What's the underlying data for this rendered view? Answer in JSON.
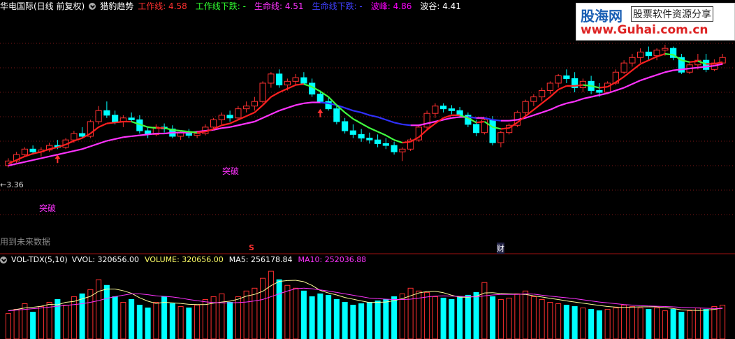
{
  "header": {
    "title": "华电国际(日线 前复权)",
    "indicator_name": "猎豹趋势",
    "items": [
      {
        "label": "工作线: 4.58",
        "color": "#ff3030"
      },
      {
        "label": "工作线下跌: -",
        "color": "#30ff30"
      },
      {
        "label": "生命线: 4.51",
        "color": "#ff33ff"
      },
      {
        "label": "生命线下跌: -",
        "color": "#4040ff"
      },
      {
        "label": "波峰: 4.86",
        "color": "#ff00ff"
      },
      {
        "label": "波谷: 4.41",
        "color": "#ffffff"
      }
    ]
  },
  "logo": {
    "line1": "股海网",
    "tag": "股票软件资源分享",
    "line2": "www.Guhai.com.cn"
  },
  "annotations": {
    "price_low": "←3.36",
    "breakout1": "突破",
    "breakout2": "突破",
    "footer_text": "用到未来数据",
    "marker_s": "S",
    "marker_cai": "财"
  },
  "volume_header": {
    "name": "VOL-TDX(5,10)",
    "items": [
      {
        "label": "VVOL: 320656.00",
        "color": "#ffffff"
      },
      {
        "label": "VOLUME: 320656.00",
        "color": "#ffff66"
      },
      {
        "label": "MA5: 256178.84",
        "color": "#ffffff"
      },
      {
        "label": "MA10: 252036.88",
        "color": "#ff33ff"
      }
    ]
  },
  "colors": {
    "up": "#ff3030",
    "down": "#00ffff",
    "work": "#ff2020",
    "work_down": "#40ff40",
    "life": "#ff33ff",
    "life_down": "#3030ff",
    "grid": "#801818"
  },
  "chart_data": [
    {
      "type": "candlestick",
      "title": "猎豹趋势",
      "ylim": [
        3.3,
        4.75
      ],
      "ohlc": [
        [
          3.4,
          3.48,
          3.38,
          3.45
        ],
        [
          3.45,
          3.55,
          3.43,
          3.52
        ],
        [
          3.52,
          3.6,
          3.5,
          3.58
        ],
        [
          3.58,
          3.62,
          3.52,
          3.55
        ],
        [
          3.55,
          3.6,
          3.5,
          3.57
        ],
        [
          3.57,
          3.65,
          3.55,
          3.62
        ],
        [
          3.62,
          3.68,
          3.58,
          3.6
        ],
        [
          3.6,
          3.7,
          3.58,
          3.68
        ],
        [
          3.68,
          3.78,
          3.65,
          3.75
        ],
        [
          3.75,
          3.82,
          3.7,
          3.72
        ],
        [
          3.72,
          3.9,
          3.7,
          3.88
        ],
        [
          3.88,
          4.05,
          3.85,
          4.0
        ],
        [
          4.0,
          4.1,
          3.92,
          3.95
        ],
        [
          3.95,
          4.0,
          3.85,
          3.88
        ],
        [
          3.88,
          3.95,
          3.82,
          3.92
        ],
        [
          3.92,
          3.98,
          3.88,
          3.9
        ],
        [
          3.9,
          3.95,
          3.75,
          3.78
        ],
        [
          3.78,
          3.82,
          3.7,
          3.74
        ],
        [
          3.74,
          3.85,
          3.72,
          3.82
        ],
        [
          3.82,
          3.86,
          3.76,
          3.8
        ],
        [
          3.8,
          3.84,
          3.7,
          3.72
        ],
        [
          3.72,
          3.78,
          3.68,
          3.76
        ],
        [
          3.76,
          3.8,
          3.7,
          3.73
        ],
        [
          3.73,
          3.78,
          3.7,
          3.75
        ],
        [
          3.75,
          3.85,
          3.73,
          3.82
        ],
        [
          3.82,
          3.92,
          3.8,
          3.9
        ],
        [
          3.9,
          3.98,
          3.85,
          3.95
        ],
        [
          3.95,
          4.0,
          3.88,
          3.92
        ],
        [
          3.92,
          4.05,
          3.9,
          4.02
        ],
        [
          4.02,
          4.1,
          3.98,
          4.05
        ],
        [
          4.05,
          4.15,
          4.0,
          4.1
        ],
        [
          4.1,
          4.32,
          4.08,
          4.3
        ],
        [
          4.3,
          4.42,
          4.25,
          4.4
        ],
        [
          4.4,
          4.45,
          4.25,
          4.28
        ],
        [
          4.28,
          4.35,
          4.22,
          4.32
        ],
        [
          4.32,
          4.4,
          4.28,
          4.36
        ],
        [
          4.36,
          4.42,
          4.28,
          4.3
        ],
        [
          4.3,
          4.35,
          4.15,
          4.18
        ],
        [
          4.18,
          4.22,
          4.08,
          4.1
        ],
        [
          4.1,
          4.15,
          4.0,
          4.02
        ],
        [
          4.02,
          4.05,
          3.85,
          3.88
        ],
        [
          3.88,
          3.92,
          3.75,
          3.78
        ],
        [
          3.78,
          3.85,
          3.7,
          3.74
        ],
        [
          3.74,
          3.8,
          3.66,
          3.7
        ],
        [
          3.7,
          3.76,
          3.64,
          3.68
        ],
        [
          3.68,
          3.74,
          3.6,
          3.64
        ],
        [
          3.64,
          3.7,
          3.58,
          3.62
        ],
        [
          3.62,
          3.66,
          3.52,
          3.55
        ],
        [
          3.55,
          3.6,
          3.45,
          3.58
        ],
        [
          3.58,
          3.7,
          3.56,
          3.68
        ],
        [
          3.68,
          3.85,
          3.66,
          3.82
        ],
        [
          3.82,
          4.0,
          3.8,
          3.97
        ],
        [
          3.97,
          4.08,
          3.92,
          4.05
        ],
        [
          4.05,
          4.08,
          3.98,
          4.02
        ],
        [
          4.02,
          4.06,
          3.96,
          4.0
        ],
        [
          4.0,
          4.04,
          3.92,
          3.95
        ],
        [
          3.95,
          3.98,
          3.82,
          3.85
        ],
        [
          3.85,
          3.9,
          3.72,
          3.76
        ],
        [
          3.76,
          3.92,
          3.74,
          3.9
        ],
        [
          3.9,
          3.94,
          3.62,
          3.65
        ],
        [
          3.65,
          3.78,
          3.6,
          3.76
        ],
        [
          3.76,
          3.86,
          3.74,
          3.84
        ],
        [
          3.84,
          4.0,
          3.82,
          3.98
        ],
        [
          3.98,
          4.12,
          3.95,
          4.1
        ],
        [
          4.1,
          4.18,
          4.05,
          4.15
        ],
        [
          4.15,
          4.25,
          4.1,
          4.22
        ],
        [
          4.22,
          4.32,
          4.18,
          4.3
        ],
        [
          4.3,
          4.4,
          4.25,
          4.38
        ],
        [
          4.38,
          4.45,
          4.3,
          4.35
        ],
        [
          4.35,
          4.42,
          4.2,
          4.25
        ],
        [
          4.25,
          4.35,
          4.2,
          4.32
        ],
        [
          4.32,
          4.38,
          4.18,
          4.22
        ],
        [
          4.22,
          4.3,
          4.15,
          4.2
        ],
        [
          4.2,
          4.32,
          4.18,
          4.3
        ],
        [
          4.3,
          4.45,
          4.28,
          4.42
        ],
        [
          4.42,
          4.55,
          4.4,
          4.52
        ],
        [
          4.52,
          4.62,
          4.48,
          4.58
        ],
        [
          4.58,
          4.68,
          4.52,
          4.64
        ],
        [
          4.64,
          4.7,
          4.55,
          4.6
        ],
        [
          4.6,
          4.68,
          4.55,
          4.66
        ],
        [
          4.66,
          4.72,
          4.6,
          4.68
        ],
        [
          4.68,
          4.7,
          4.55,
          4.58
        ],
        [
          4.58,
          4.62,
          4.4,
          4.42
        ],
        [
          4.42,
          4.52,
          4.4,
          4.5
        ],
        [
          4.5,
          4.62,
          4.45,
          4.55
        ],
        [
          4.55,
          4.62,
          4.42,
          4.45
        ],
        [
          4.45,
          4.56,
          4.43,
          4.52
        ],
        [
          4.52,
          4.62,
          4.5,
          4.58
        ]
      ],
      "work_line": [
        3.42,
        3.46,
        3.5,
        3.53,
        3.55,
        3.58,
        3.6,
        3.63,
        3.67,
        3.7,
        3.75,
        3.82,
        3.86,
        3.87,
        3.88,
        3.88,
        3.85,
        3.82,
        3.81,
        3.81,
        3.79,
        3.78,
        3.77,
        3.76,
        3.77,
        3.8,
        3.84,
        3.86,
        3.9,
        3.94,
        3.98,
        4.06,
        4.15,
        4.2,
        4.24,
        4.28,
        4.29,
        4.26,
        4.21,
        4.15,
        4.06,
        3.98,
        3.91,
        3.86,
        3.81,
        3.77,
        3.73,
        3.68,
        3.65,
        3.66,
        3.71,
        3.79,
        3.86,
        3.92,
        3.95,
        3.95,
        3.92,
        3.87,
        3.88,
        3.82,
        3.8,
        3.81,
        3.87,
        3.94,
        4.01,
        4.08,
        4.15,
        4.23,
        4.27,
        4.27,
        4.28,
        4.27,
        4.25,
        4.26,
        4.31,
        4.37,
        4.44,
        4.51,
        4.55,
        4.59,
        4.62,
        4.61,
        4.55,
        4.53,
        4.54,
        4.51,
        4.51,
        4.53
      ],
      "life_line": [
        3.4,
        3.42,
        3.44,
        3.46,
        3.48,
        3.5,
        3.52,
        3.54,
        3.56,
        3.58,
        3.61,
        3.64,
        3.67,
        3.69,
        3.71,
        3.72,
        3.73,
        3.74,
        3.75,
        3.75,
        3.76,
        3.76,
        3.76,
        3.77,
        3.78,
        3.79,
        3.81,
        3.82,
        3.84,
        3.86,
        3.88,
        3.92,
        3.96,
        4.0,
        4.03,
        4.06,
        4.08,
        4.09,
        4.09,
        4.08,
        4.06,
        4.03,
        4.0,
        3.98,
        3.95,
        3.93,
        3.9,
        3.87,
        3.85,
        3.84,
        3.84,
        3.86,
        3.88,
        3.9,
        3.92,
        3.93,
        3.93,
        3.92,
        3.92,
        3.9,
        3.89,
        3.89,
        3.9,
        3.92,
        3.95,
        3.98,
        4.01,
        4.05,
        4.08,
        4.1,
        4.13,
        4.15,
        4.17,
        4.19,
        4.22,
        4.25,
        4.29,
        4.33,
        4.36,
        4.39,
        4.42,
        4.44,
        4.45,
        4.46,
        4.47,
        4.48,
        4.49,
        4.51
      ]
    },
    {
      "type": "bar",
      "title": "VOL-TDX(5,10)",
      "series": [
        {
          "name": "VOLUME",
          "values": [
            180,
            210,
            250,
            190,
            230,
            260,
            280,
            240,
            300,
            320,
            350,
            420,
            380,
            300,
            260,
            280,
            240,
            220,
            260,
            300,
            250,
            230,
            220,
            240,
            280,
            300,
            320,
            260,
            300,
            340,
            360,
            430,
            480,
            420,
            380,
            360,
            340,
            300,
            320,
            310,
            280,
            260,
            240,
            250,
            260,
            270,
            280,
            300,
            320,
            360,
            340,
            330,
            300,
            290,
            280,
            300,
            310,
            330,
            400,
            300,
            280,
            290,
            320,
            340,
            300,
            280,
            260,
            250,
            240,
            230,
            220,
            210,
            200,
            210,
            220,
            240,
            230,
            220,
            210,
            220,
            200,
            210,
            190,
            200,
            220,
            210,
            230,
            240
          ]
        },
        {
          "name": "MA5",
          "values": [
            200,
            210,
            220,
            225,
            232,
            246,
            242,
            260,
            266,
            284,
            302,
            338,
            354,
            354,
            342,
            324,
            292,
            268,
            252,
            260,
            256,
            252,
            246,
            244,
            244,
            254,
            262,
            268,
            282,
            304,
            316,
            338,
            378,
            408,
            414,
            416,
            406,
            380,
            344,
            326,
            312,
            294,
            282,
            270,
            258,
            260,
            262,
            272,
            286,
            306,
            326,
            336,
            338,
            328,
            310,
            296,
            296,
            302,
            326,
            328,
            322,
            320,
            318,
            316,
            306,
            298,
            288,
            280,
            270,
            262,
            254,
            246,
            238,
            230,
            226,
            224,
            226,
            228,
            228,
            228,
            222,
            216,
            206,
            204,
            202,
            204,
            210,
            220
          ]
        },
        {
          "name": "MA10",
          "values": [
            200,
            205,
            210,
            215,
            220,
            226,
            232,
            238,
            244,
            250,
            260,
            272,
            288,
            300,
            310,
            320,
            320,
            314,
            306,
            302,
            298,
            290,
            280,
            272,
            264,
            258,
            256,
            256,
            258,
            262,
            270,
            280,
            300,
            320,
            340,
            356,
            360,
            356,
            348,
            340,
            330,
            320,
            310,
            300,
            290,
            286,
            282,
            280,
            280,
            282,
            290,
            298,
            304,
            306,
            304,
            302,
            300,
            298,
            306,
            312,
            316,
            316,
            316,
            320,
            318,
            310,
            304,
            298,
            292,
            286,
            278,
            270,
            262,
            256,
            250,
            244,
            240,
            236,
            234,
            232,
            230,
            228,
            224,
            222,
            220,
            218,
            216,
            216
          ]
        }
      ]
    }
  ]
}
